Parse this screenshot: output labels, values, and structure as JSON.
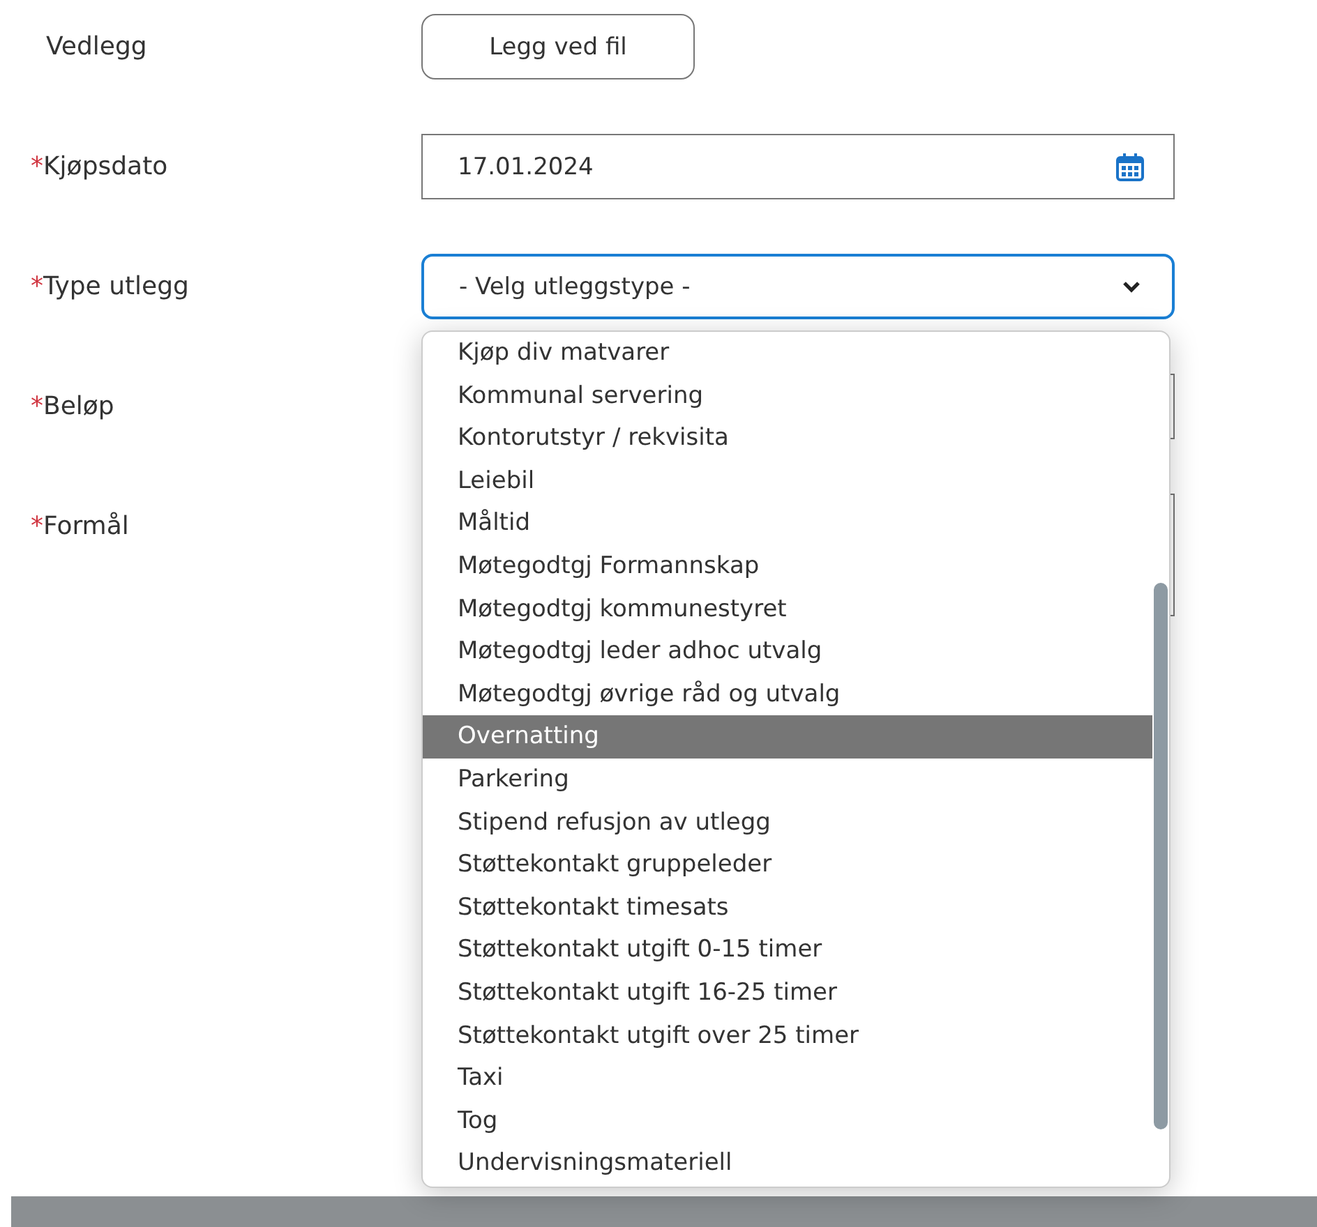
{
  "fields": [
    {
      "kind": "file",
      "label": "Vedlegg",
      "required": false,
      "button": "Legg ved fil"
    },
    {
      "kind": "date",
      "label": "Kjøpsdato",
      "required": true,
      "required_mark": "*",
      "value": "17.01.2024"
    },
    {
      "kind": "select",
      "label": "Type utlegg",
      "required": true,
      "required_mark": "*",
      "value": "- Velg utleggstype -",
      "expanded": true,
      "options": [
        {
          "label": "Kjøp div matvarer",
          "selected": false
        },
        {
          "label": "Kommunal servering",
          "selected": false
        },
        {
          "label": "Kontorutstyr / rekvisita",
          "selected": false
        },
        {
          "label": "Leiebil",
          "selected": false
        },
        {
          "label": "Måltid",
          "selected": false
        },
        {
          "label": "Møtegodtgj Formannskap",
          "selected": false
        },
        {
          "label": "Møtegodtgj kommunestyret",
          "selected": false
        },
        {
          "label": "Møtegodtgj leder adhoc utvalg",
          "selected": false
        },
        {
          "label": "Møtegodtgj øvrige råd og utvalg",
          "selected": false
        },
        {
          "label": "Overnatting",
          "selected": true
        },
        {
          "label": "Parkering",
          "selected": false
        },
        {
          "label": "Stipend refusjon av utlegg",
          "selected": false
        },
        {
          "label": "Støttekontakt gruppeleder",
          "selected": false
        },
        {
          "label": "Støttekontakt timesats",
          "selected": false
        },
        {
          "label": "Støttekontakt utgift 0-15 timer",
          "selected": false
        },
        {
          "label": "Støttekontakt utgift 16-25 timer",
          "selected": false
        },
        {
          "label": "Støttekontakt utgift over 25 timer",
          "selected": false
        },
        {
          "label": "Taxi",
          "selected": false
        },
        {
          "label": "Tog",
          "selected": false
        },
        {
          "label": "Undervisningsmateriell",
          "selected": false
        }
      ]
    },
    {
      "kind": "text",
      "label": "Beløp",
      "required": true,
      "required_mark": "*"
    },
    {
      "kind": "textarea",
      "label": "Formål",
      "required": true,
      "required_mark": "*"
    }
  ]
}
